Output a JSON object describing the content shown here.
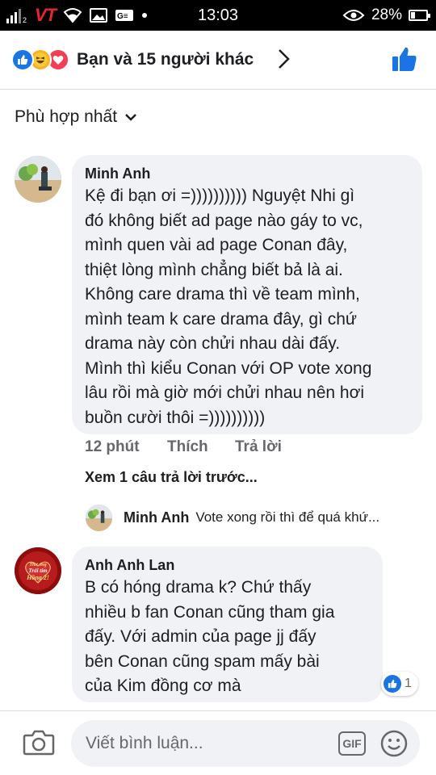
{
  "status_bar": {
    "time": "13:03",
    "battery": "28%",
    "battery_level": 0.28,
    "carrier_logo": "VT",
    "sim_slot": "2"
  },
  "reactions": {
    "summary": "Bạn và 15 người khác",
    "icons": [
      "like-icon",
      "haha-icon",
      "love-icon"
    ]
  },
  "sort": {
    "label": "Phù hợp nhất"
  },
  "comments": [
    {
      "name": "Minh Anh",
      "text": "Kệ đi bạn ơi =)))))))))) Nguyệt Nhi gì\nđó không biết ad page nào gáy to vc,\nmình quen vài ad page Conan đây,\nthiệt lòng mình chẳng biết bả là ai.\nKhông care drama thì về team mình,\nmình team k care drama đây, gì chứ\ndrama này còn chửi nhau dài đấy.\nMình thì kiểu Conan với OP vote xong\nlâu rồi mà giờ mới chửi nhau nên hơi\nbuồn cười thôi =))))))))))",
      "time": "12 phút",
      "like_label": "Thích",
      "reply_label": "Trả lời",
      "view_previous": "Xem 1 câu trả lời trước...",
      "reply": {
        "name": "Minh Anh",
        "text": "Vote xong rồi thì để quá khứ..."
      }
    },
    {
      "name": "Anh Anh Lan",
      "avatar_text": "Thơ ơng Trái tim Hồng 2!",
      "text": "B có hóng drama k?  Chứ thấy\nnhiều b fan Conan cũng tham gia\nđấy. Với admin của page jj đấy\nbên Conan cũng spam mấy bài\ncủa Kim đồng cơ mà",
      "like_count": "1"
    }
  ],
  "composer": {
    "placeholder": "Viết bình luận...",
    "gif_label": "GIF"
  },
  "colors": {
    "accent": "#1b74e4",
    "bubble": "#f0f2f5",
    "secondary_text": "#65676b"
  }
}
